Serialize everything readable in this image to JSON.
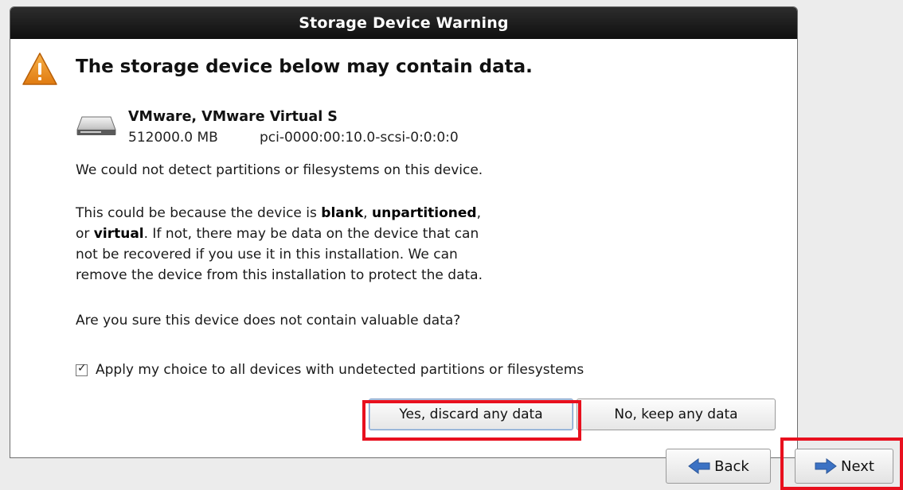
{
  "dialog": {
    "title": "Storage Device Warning",
    "heading": "The storage device below may contain data.",
    "device": {
      "name": "VMware, VMware Virtual S",
      "size": "512000.0 MB",
      "path": "pci-0000:00:10.0-scsi-0:0:0:0",
      "icon": "hard-disk-icon"
    },
    "warning_icon": "warning-triangle-icon",
    "paragraph1": "We could not detect partitions or filesystems on this device.",
    "paragraph2": {
      "line1_a": "This could be because the device is ",
      "blank": "blank",
      "line1_b": ", ",
      "unpartitioned": "unpartitioned",
      "line1_c": ",",
      "line2_a": "or ",
      "virtual": "virtual",
      "line2_b": ". If not, there may be data on the device that can",
      "line3": "not be recovered if you use it in this installation. We can",
      "line4": "remove the device from this installation to protect the data."
    },
    "paragraph3": "Are you sure this device does not contain valuable data?",
    "apply_checkbox": {
      "checked": true,
      "label": "Apply my choice to all devices with undetected partitions or filesystems"
    },
    "yes_button": "Yes, discard any data",
    "no_button": "No, keep any data"
  },
  "navigation": {
    "back_label": "Back",
    "next_label": "Next"
  },
  "colors": {
    "titlebar": "#1a1a1a",
    "highlight": "#e8101e",
    "warning": "#f0921e",
    "arrow": "#3c72c4"
  }
}
